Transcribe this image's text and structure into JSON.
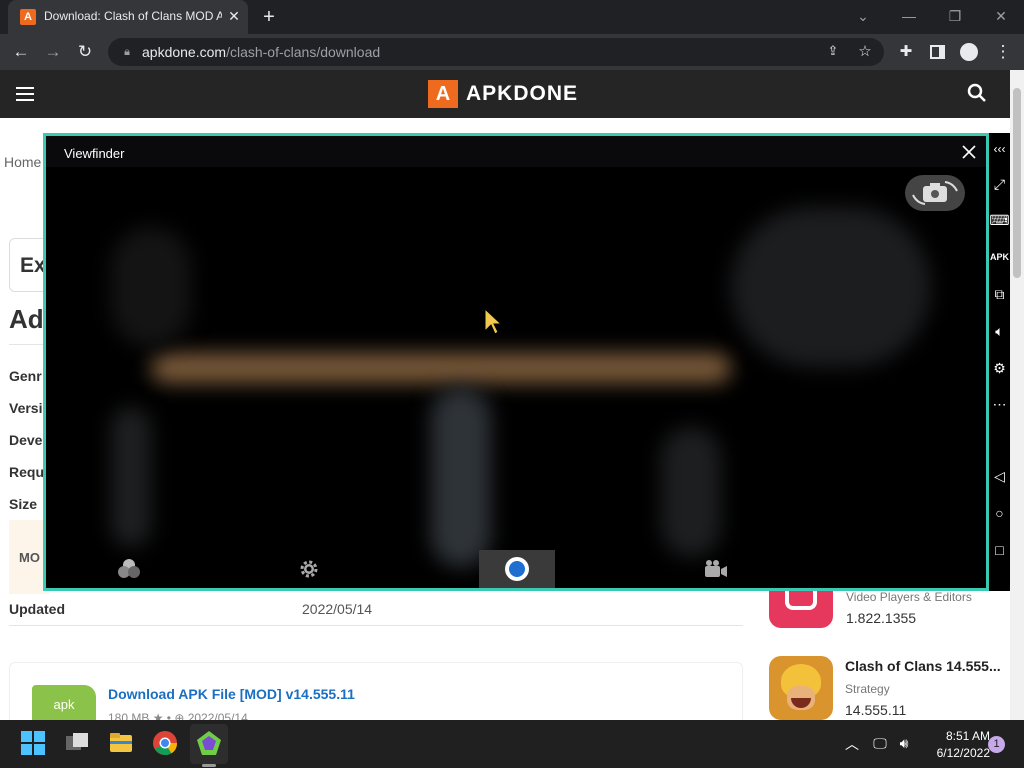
{
  "browser": {
    "tab_title": "Download: Clash of Clans MOD APK",
    "tab_favicon": "A",
    "url_host": "apkdone.com",
    "url_path": "/clash-of-clans/download"
  },
  "site": {
    "logo_letter": "A",
    "logo_text": "APKDONE"
  },
  "page": {
    "breadcrumb_home": "Home",
    "heading_partial": "Ex",
    "section_partial": "Ad",
    "info_labels": [
      "Genr",
      "Versi",
      "Deve",
      "Requ",
      "Size"
    ],
    "mod_label": "MO",
    "updated_label": "Updated",
    "updated_value": "2022/05/14",
    "download_badge": "apk",
    "download_link": "Download APK File [MOD] v14.555.11",
    "download_meta": "180 MB ★ • ⊕ 2022/05/14",
    "side_app1_category": "Video Players & Editors",
    "side_app1_version": "1.822.1355",
    "side_app2_name": "Clash of Clans 14.555...",
    "side_app2_category": "Strategy",
    "side_app2_version": "14.555.11"
  },
  "viewfinder": {
    "title": "Viewfinder",
    "icons": [
      "close-icon",
      "switch-camera-icon",
      "filters-icon",
      "settings-icon",
      "shutter-button",
      "video-mode-icon"
    ]
  },
  "emulator_sidebar": {
    "icons": [
      "collapse-icon",
      "fullscreen-icon",
      "keyboard-icon",
      "apk-install-icon",
      "multi-instance-icon",
      "volume-icon",
      "settings-icon",
      "more-icon",
      "back-icon",
      "home-icon",
      "recents-icon"
    ]
  },
  "taskbar": {
    "time": "8:51 AM",
    "date": "6/12/2022",
    "notification_count": "1"
  },
  "colors": {
    "accent_orange": "#ee6a1f",
    "viewfinder_border": "#3ac9b3",
    "link_blue": "#1a6fc2"
  }
}
